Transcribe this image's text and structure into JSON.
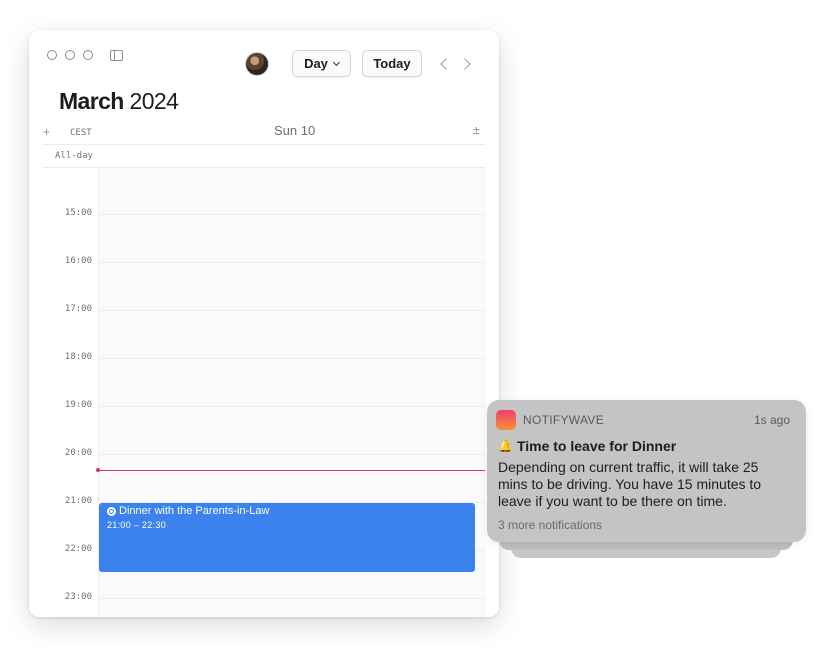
{
  "calendar": {
    "month": "March",
    "year": "2024",
    "view_label": "Day",
    "today_label": "Today",
    "add_symbol": "+",
    "timezone": "CEST",
    "day_header": "Sun 10",
    "collapse_symbol": "±",
    "allday_label": "All-day",
    "hours": [
      "15:00",
      "16:00",
      "17:00",
      "18:00",
      "19:00",
      "20:00",
      "21:00",
      "22:00",
      "23:00"
    ],
    "current_time_color": "#d33a55",
    "event": {
      "title": "Dinner with the Parents-in-Law",
      "time": "21:00 – 22:30",
      "color": "#3b82ee",
      "icon": "plate-icon"
    }
  },
  "notification": {
    "app_name": "NOTIFYWAVE",
    "time_ago": "1s ago",
    "icon": "bell-icon",
    "title": "Time to leave for Dinner",
    "body": "Depending on current traffic, it will take 25 mins to be driving. You have 15 minutes to leave if you want to be there on time.",
    "more": "3 more notifications"
  }
}
